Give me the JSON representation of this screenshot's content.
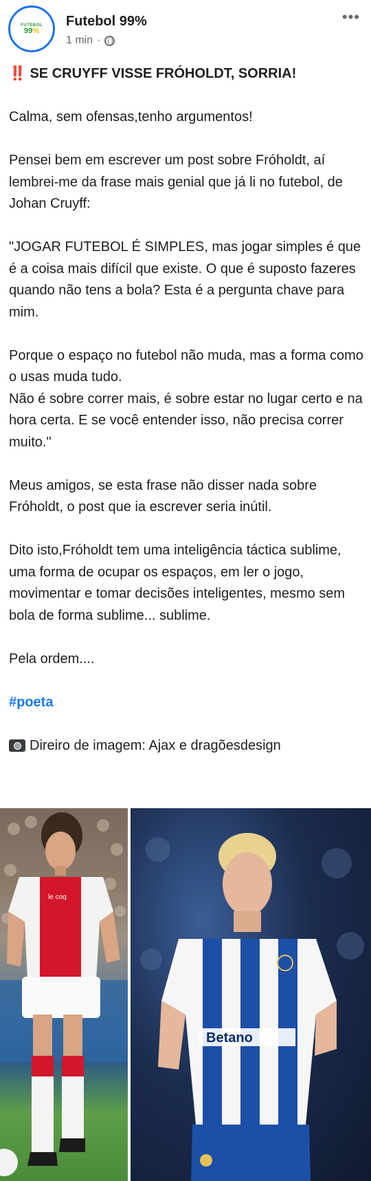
{
  "header": {
    "page_name": "Futebol 99%",
    "time": "1 min",
    "separator": "·",
    "more_label": "•••",
    "logo_top": "FUTEBOL",
    "logo_main_a": "99",
    "logo_main_b": "%"
  },
  "post": {
    "title_emoji": "‼️",
    "title_text": "SE CRUYFF VISSE FRÓHOLDT, SORRIA!",
    "paragraphs": [
      "Calma, sem ofensas,tenho argumentos!",
      "Pensei bem em escrever um post sobre Fróholdt, aí lembrei-me da frase mais genial que já li no futebol, de Johan Cruyff:",
      "\"JOGAR FUTEBOL É SIMPLES, mas jogar simples é que é a coisa mais difícil que existe. O que é suposto fazeres quando não tens a bola? Esta é a pergunta chave para mim.",
      "Porque o espaço no futebol não muda, mas a forma como o usas muda tudo.",
      "Não é sobre correr mais, é sobre estar no lugar certo e na hora certa. E se você entender isso, não precisa correr muito.\"",
      "Meus amigos, se esta frase não disser nada sobre Fróholdt, o post que ia escrever seria inútil.",
      "Dito isto,Fróholdt tem uma inteligência táctica sublime, uma forma de ocupar os espaços, em ler o jogo, movimentar e tomar decisões inteligentes, mesmo sem bola de forma sublime... sublime.",
      "Pela ordem...."
    ],
    "hashtag": "#poeta",
    "photo_credit": "Direiro de imagem: Ajax e dragõesdesign"
  },
  "images": {
    "left_shirt_text": "le coq",
    "right_shirt_sponsor": "Betano"
  },
  "colors": {
    "accent_blue": "#1877f2",
    "avatar_ring": "#1d73ea",
    "title_emoji_red": "#e0242e",
    "ajax_red": "#d3162a",
    "porto_blue": "#1c4fa8"
  }
}
